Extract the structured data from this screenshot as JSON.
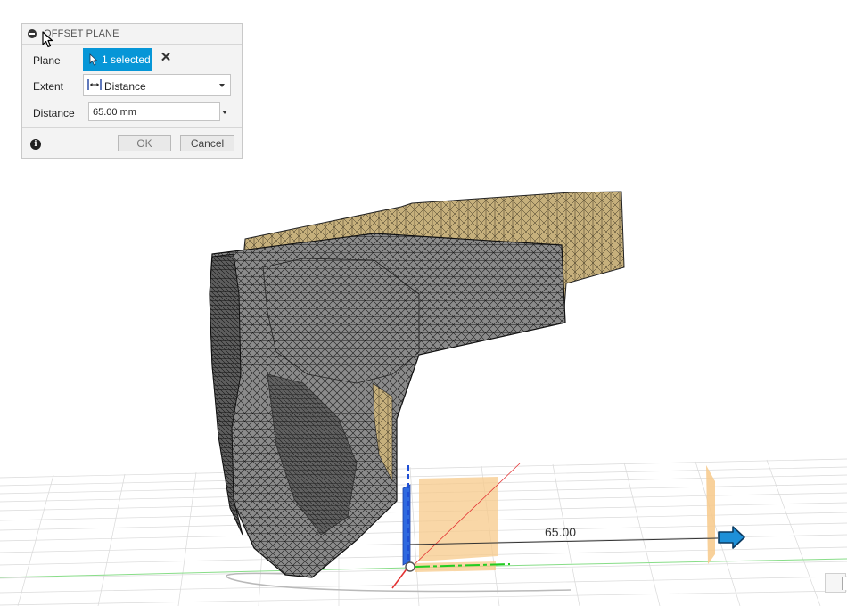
{
  "dialog": {
    "title": "OFFSET PLANE",
    "plane_label": "Plane",
    "plane_selection": "1 selected",
    "extent_label": "Extent",
    "extent_value": "Distance",
    "distance_label": "Distance",
    "distance_value": "65.00 mm",
    "ok_label": "OK",
    "cancel_label": "Cancel"
  },
  "viewport": {
    "dimension_label": "65.00"
  },
  "colors": {
    "accent_blue": "#0696d7",
    "mesh_gray": "#8e8e8e",
    "mesh_tan": "#c2ad7a",
    "plane_orange": "#f7c98a",
    "axis_green": "#22cc22",
    "axis_blue": "#1f4fd6",
    "axis_red": "#e33333"
  },
  "icons": [
    "collapse-icon",
    "cursor-arrow-icon",
    "selection-arrow-icon",
    "clear-selection-icon",
    "distance-extent-icon",
    "chevron-down-icon",
    "info-icon",
    "manipulator-arrow-icon"
  ]
}
